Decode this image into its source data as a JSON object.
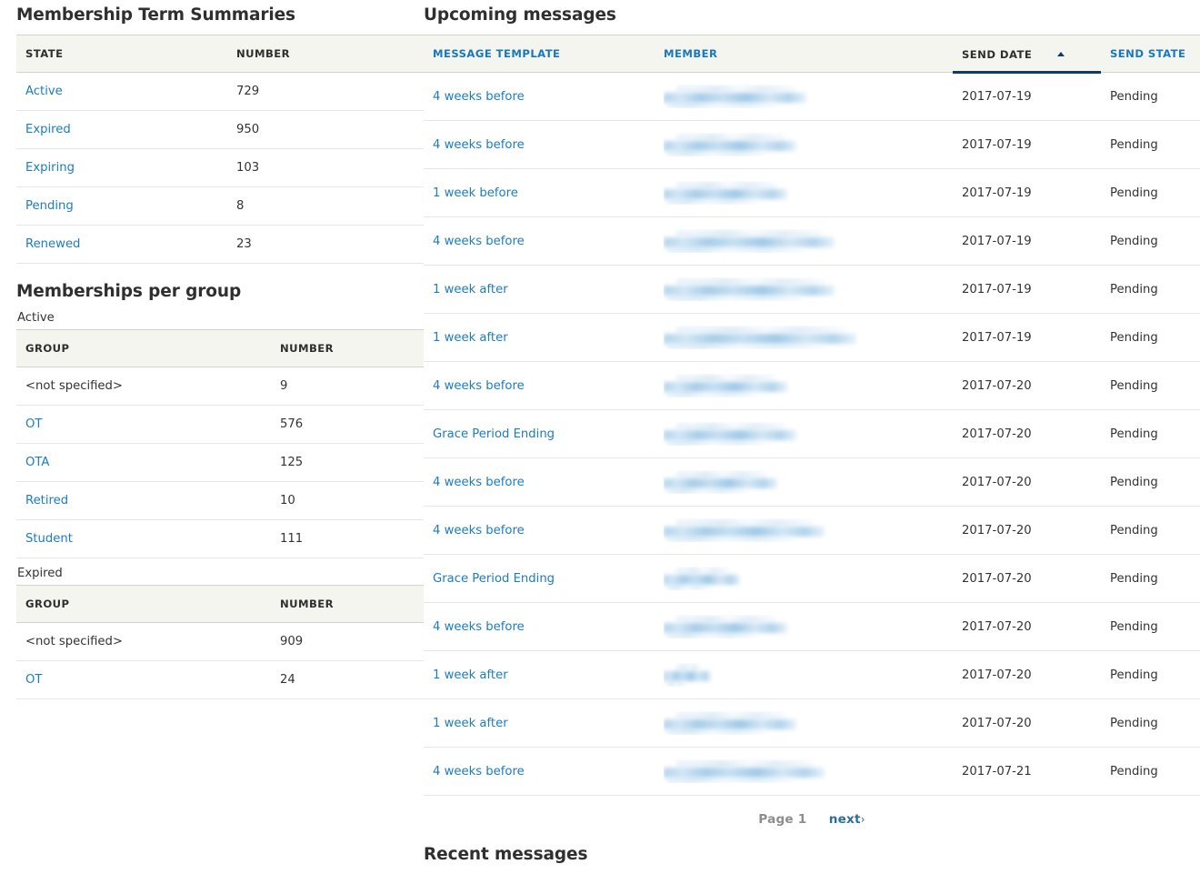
{
  "left": {
    "term_summaries": {
      "title": "Membership Term Summaries",
      "columns": [
        "STATE",
        "NUMBER"
      ],
      "rows": [
        {
          "state": "Active",
          "number": "729"
        },
        {
          "state": "Expired",
          "number": "950"
        },
        {
          "state": "Expiring",
          "number": "103"
        },
        {
          "state": "Pending",
          "number": "8"
        },
        {
          "state": "Renewed",
          "number": "23"
        }
      ]
    },
    "per_group": {
      "title": "Memberships per group",
      "columns": [
        "GROUP",
        "NUMBER"
      ],
      "sections": [
        {
          "label": "Active",
          "rows": [
            {
              "group": "<not specified>",
              "number": "9",
              "link": false
            },
            {
              "group": "OT",
              "number": "576",
              "link": true
            },
            {
              "group": "OTA",
              "number": "125",
              "link": true
            },
            {
              "group": "Retired",
              "number": "10",
              "link": true
            },
            {
              "group": "Student",
              "number": "111",
              "link": true
            }
          ]
        },
        {
          "label": "Expired",
          "rows": [
            {
              "group": "<not specified>",
              "number": "909",
              "link": false
            },
            {
              "group": "OT",
              "number": "24",
              "link": true
            }
          ]
        }
      ]
    }
  },
  "right": {
    "upcoming": {
      "title": "Upcoming messages",
      "columns": {
        "message_template": "MESSAGE TEMPLATE",
        "member": "MEMBER",
        "send_date": "SEND DATE",
        "send_state": "SEND STATE"
      },
      "sort": {
        "column": "SEND DATE",
        "direction": "ascending",
        "icon": "sort-ascending-icon"
      },
      "rows": [
        {
          "template": "4 weeks before",
          "member": "redacted",
          "member_width": 157,
          "send_date": "2017-07-19",
          "send_state": "Pending"
        },
        {
          "template": "4 weeks before",
          "member": "redacted",
          "member_width": 146,
          "send_date": "2017-07-19",
          "send_state": "Pending"
        },
        {
          "template": "1 week before",
          "member": "redacted",
          "member_width": 136,
          "send_date": "2017-07-19",
          "send_state": "Pending"
        },
        {
          "template": "4 weeks before",
          "member": "redacted",
          "member_width": 188,
          "send_date": "2017-07-19",
          "send_state": "Pending"
        },
        {
          "template": "1 week after",
          "member": "redacted",
          "member_width": 188,
          "send_date": "2017-07-19",
          "send_state": "Pending"
        },
        {
          "template": "1 week after",
          "member": "redacted",
          "member_width": 212,
          "send_date": "2017-07-19",
          "send_state": "Pending"
        },
        {
          "template": "4 weeks before",
          "member": "redacted",
          "member_width": 136,
          "send_date": "2017-07-20",
          "send_state": "Pending"
        },
        {
          "template": "Grace Period Ending",
          "member": "redacted",
          "member_width": 146,
          "send_date": "2017-07-20",
          "send_state": "Pending"
        },
        {
          "template": "4 weeks before",
          "member": "redacted",
          "member_width": 125,
          "send_date": "2017-07-20",
          "send_state": "Pending"
        },
        {
          "template": "4 weeks before",
          "member": "redacted",
          "member_width": 177,
          "send_date": "2017-07-20",
          "send_state": "Pending"
        },
        {
          "template": "Grace Period Ending",
          "member": "redacted",
          "member_width": 84,
          "send_date": "2017-07-20",
          "send_state": "Pending"
        },
        {
          "template": "4 weeks before",
          "member": "redacted",
          "member_width": 136,
          "send_date": "2017-07-20",
          "send_state": "Pending"
        },
        {
          "template": "1 week after",
          "member": "redacted",
          "member_width": 52,
          "send_date": "2017-07-20",
          "send_state": "Pending"
        },
        {
          "template": "1 week after",
          "member": "redacted",
          "member_width": 146,
          "send_date": "2017-07-20",
          "send_state": "Pending"
        },
        {
          "template": "4 weeks before",
          "member": "redacted",
          "member_width": 177,
          "send_date": "2017-07-21",
          "send_state": "Pending"
        }
      ],
      "pagination": {
        "current": "Page 1",
        "next": "next",
        "next_chevron": "›"
      }
    },
    "recent": {
      "title": "Recent messages"
    }
  },
  "colors": {
    "link": "#1c7cc4",
    "header_link": "#1878bd",
    "sort_underline": "#0b3d68",
    "header_bg": "#f5f5f0",
    "text": "#333333",
    "pager_current": "#8d8d8d"
  }
}
